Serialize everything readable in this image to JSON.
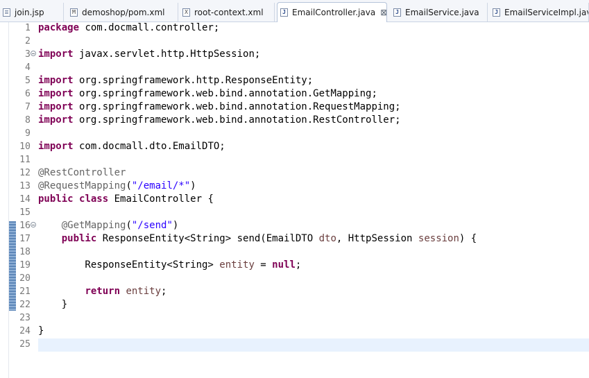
{
  "tabs": [
    {
      "label": "join.jsp",
      "icon": "jsp-file-icon"
    },
    {
      "label": "demoshop/pom.xml",
      "icon": "maven-pom-icon",
      "icon_text": "M"
    },
    {
      "label": "root-context.xml",
      "icon": "xml-file-icon",
      "icon_text": "X"
    },
    {
      "label": "EmailController.java",
      "icon": "java-file-icon",
      "icon_text": "J",
      "active": true,
      "close": "⊠"
    },
    {
      "label": "EmailService.java",
      "icon": "java-file-icon",
      "icon_text": "J"
    },
    {
      "label": "EmailServiceImpl.java",
      "icon": "java-file-icon",
      "icon_text": "J"
    }
  ],
  "editor": {
    "current_line": 25,
    "folded_lines": [
      3,
      16
    ],
    "change_marks_lines": [
      16,
      22
    ],
    "lines": [
      {
        "n": "1",
        "tokens": [
          [
            "kw",
            "package"
          ],
          [
            "p",
            " com.docmall.controller;"
          ]
        ]
      },
      {
        "n": "2",
        "tokens": []
      },
      {
        "n": "3",
        "tokens": [
          [
            "kw",
            "import"
          ],
          [
            "p",
            " javax.servlet.http.HttpSession;"
          ]
        ]
      },
      {
        "n": "4",
        "tokens": []
      },
      {
        "n": "5",
        "tokens": [
          [
            "kw",
            "import"
          ],
          [
            "p",
            " org.springframework.http.ResponseEntity;"
          ]
        ]
      },
      {
        "n": "6",
        "tokens": [
          [
            "kw",
            "import"
          ],
          [
            "p",
            " org.springframework.web.bind.annotation.GetMapping;"
          ]
        ]
      },
      {
        "n": "7",
        "tokens": [
          [
            "kw",
            "import"
          ],
          [
            "p",
            " org.springframework.web.bind.annotation.RequestMapping;"
          ]
        ]
      },
      {
        "n": "8",
        "tokens": [
          [
            "kw",
            "import"
          ],
          [
            "p",
            " org.springframework.web.bind.annotation.RestController;"
          ]
        ]
      },
      {
        "n": "9",
        "tokens": []
      },
      {
        "n": "10",
        "tokens": [
          [
            "kw",
            "import"
          ],
          [
            "p",
            " com.docmall.dto.EmailDTO;"
          ]
        ]
      },
      {
        "n": "11",
        "tokens": []
      },
      {
        "n": "12",
        "tokens": [
          [
            "ann",
            "@RestController"
          ]
        ]
      },
      {
        "n": "13",
        "tokens": [
          [
            "ann",
            "@RequestMapping"
          ],
          [
            "p",
            "("
          ],
          [
            "str",
            "\"/email/*\""
          ],
          [
            "p",
            ")"
          ]
        ]
      },
      {
        "n": "14",
        "tokens": [
          [
            "kw",
            "public"
          ],
          [
            "p",
            " "
          ],
          [
            "kw",
            "class"
          ],
          [
            "p",
            " EmailController {"
          ]
        ]
      },
      {
        "n": "15",
        "tokens": []
      },
      {
        "n": "16",
        "tokens": [
          [
            "p",
            "    "
          ],
          [
            "ann",
            "@GetMapping"
          ],
          [
            "p",
            "("
          ],
          [
            "str",
            "\"/send\""
          ],
          [
            "p",
            ")"
          ]
        ]
      },
      {
        "n": "17",
        "tokens": [
          [
            "p",
            "    "
          ],
          [
            "kw",
            "public"
          ],
          [
            "p",
            " ResponseEntity<String> send(EmailDTO "
          ],
          [
            "var",
            "dto"
          ],
          [
            "p",
            ", HttpSession "
          ],
          [
            "var",
            "session"
          ],
          [
            "p",
            ") {"
          ]
        ]
      },
      {
        "n": "18",
        "tokens": []
      },
      {
        "n": "19",
        "tokens": [
          [
            "p",
            "        ResponseEntity<String> "
          ],
          [
            "var",
            "entity"
          ],
          [
            "p",
            " = "
          ],
          [
            "kw",
            "null"
          ],
          [
            "p",
            ";"
          ]
        ]
      },
      {
        "n": "20",
        "tokens": []
      },
      {
        "n": "21",
        "tokens": [
          [
            "p",
            "        "
          ],
          [
            "kw",
            "return"
          ],
          [
            "p",
            " "
          ],
          [
            "var",
            "entity"
          ],
          [
            "p",
            ";"
          ]
        ]
      },
      {
        "n": "22",
        "tokens": [
          [
            "p",
            "    }"
          ]
        ]
      },
      {
        "n": "23",
        "tokens": []
      },
      {
        "n": "24",
        "tokens": [
          [
            "p",
            "}"
          ]
        ]
      },
      {
        "n": "25",
        "tokens": []
      }
    ]
  },
  "colors": {
    "keyword": "#7f0055",
    "annotation": "#646464",
    "string": "#2a00ff",
    "local_variable": "#6a3e3e",
    "line_number": "#787878",
    "current_line_bg": "#e8f2fe"
  }
}
